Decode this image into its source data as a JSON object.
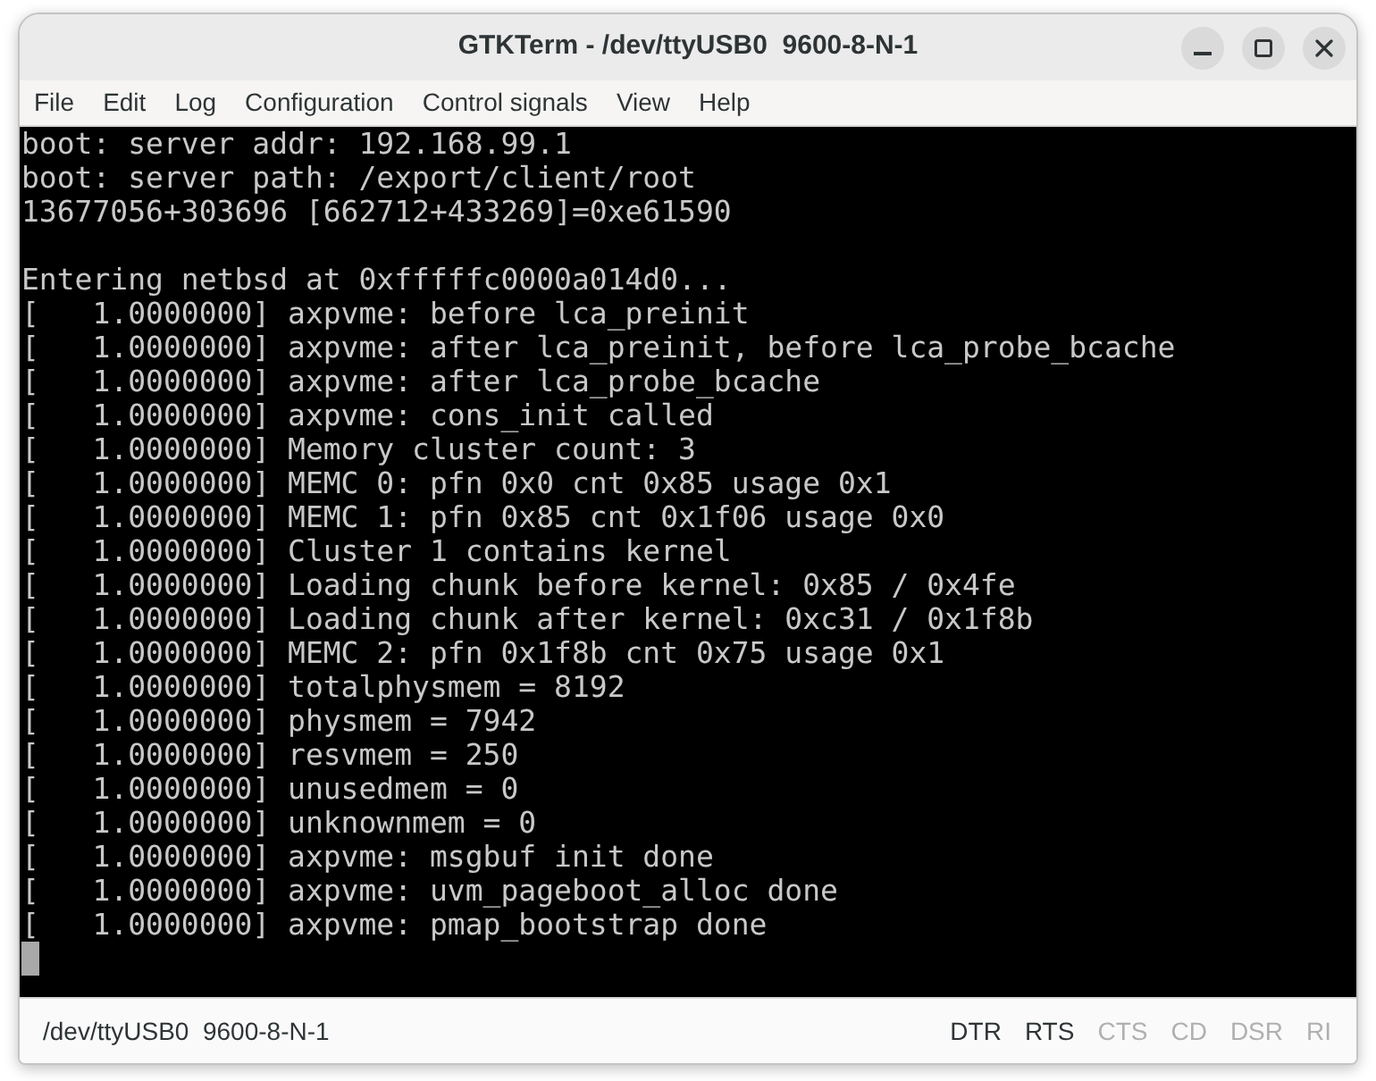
{
  "window": {
    "title": "GTKTerm - /dev/ttyUSB0  9600-8-N-1"
  },
  "menu_bar": [
    "File",
    "Edit",
    "Log",
    "Configuration",
    "Control signals",
    "View",
    "Help"
  ],
  "terminal": {
    "blocks": [
      [
        "boot: server addr: 192.168.99.1",
        "boot: server path: /export/client/root",
        "13677056+303696 [662712+433269]=0xe61590"
      ],
      [
        "Entering netbsd at 0xfffffc0000a014d0...",
        "[   1.0000000] axpvme: before lca_preinit",
        "[   1.0000000] axpvme: after lca_preinit, before lca_probe_bcache",
        "[   1.0000000] axpvme: after lca_probe_bcache",
        "[   1.0000000] axpvme: cons_init called",
        "[   1.0000000] Memory cluster count: 3",
        "[   1.0000000] MEMC 0: pfn 0x0 cnt 0x85 usage 0x1",
        "[   1.0000000] MEMC 1: pfn 0x85 cnt 0x1f06 usage 0x0",
        "[   1.0000000] Cluster 1 contains kernel",
        "[   1.0000000] Loading chunk before kernel: 0x85 / 0x4fe",
        "[   1.0000000] Loading chunk after kernel: 0xc31 / 0x1f8b",
        "[   1.0000000] MEMC 2: pfn 0x1f8b cnt 0x75 usage 0x1",
        "[   1.0000000] totalphysmem = 8192",
        "[   1.0000000] physmem = 7942",
        "[   1.0000000] resvmem = 250",
        "[   1.0000000] unusedmem = 0",
        "[   1.0000000] unknownmem = 0",
        "[   1.0000000] axpvme: msgbuf init done",
        "[   1.0000000] axpvme: uvm_pageboot_alloc done",
        "[   1.0000000] axpvme: pmap_bootstrap done"
      ]
    ]
  },
  "status_bar": {
    "port": "/dev/ttyUSB0  9600-8-N-1",
    "signals": [
      {
        "label": "DTR",
        "on": true
      },
      {
        "label": "RTS",
        "on": true
      },
      {
        "label": "CTS",
        "on": false
      },
      {
        "label": "CD",
        "on": false
      },
      {
        "label": "DSR",
        "on": false
      },
      {
        "label": "RI",
        "on": false
      }
    ]
  }
}
